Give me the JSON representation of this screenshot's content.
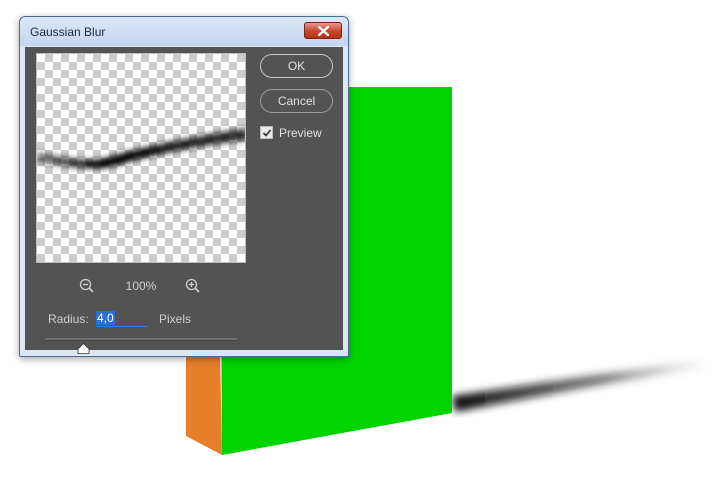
{
  "window": {
    "title": "Gaussian Blur"
  },
  "zoom": {
    "level_label": "100%"
  },
  "radius": {
    "label": "Radius:",
    "value": "4,0",
    "units": "Pixels",
    "slider_fraction": 0.2
  },
  "buttons": {
    "ok": "OK",
    "cancel": "Cancel"
  },
  "preview_toggle": {
    "label": "Preview",
    "checked": true
  },
  "colors": {
    "box_front": "#00d400",
    "box_side": "#e67e2a",
    "dialog_bg": "#535353",
    "selection": "#2f6dd6"
  },
  "icons": {
    "close": "close-x-icon",
    "zoom_out": "zoom-out-magnifier-icon",
    "zoom_in": "zoom-in-magnifier-icon",
    "checkmark": "checkmark-icon",
    "slider": "triangle-slider-thumb-icon"
  }
}
